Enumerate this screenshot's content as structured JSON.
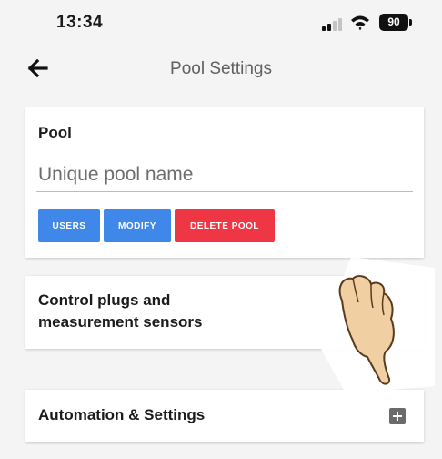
{
  "status_bar": {
    "time": "13:34",
    "battery": "90",
    "icons": [
      "signal-icon",
      "wifi-icon",
      "battery-icon"
    ]
  },
  "header": {
    "title": "Pool Settings",
    "back_icon": "arrow-left-icon"
  },
  "pool_card": {
    "title": "Pool",
    "name_placeholder": "Unique pool name",
    "buttons": {
      "users": "USERS",
      "modify": "MODIFY",
      "delete": "DELETE POOL"
    }
  },
  "plugs_card": {
    "label_line1": "Control plugs and",
    "label_line2": "measurement sensors"
  },
  "automation_card": {
    "label": "Automation & Settings",
    "expand_icon": "plus-square-icon"
  },
  "colors": {
    "primary_button": "#3f87e8",
    "danger_button": "#ef3645",
    "background": "#f4f4f4",
    "card": "#ffffff"
  }
}
